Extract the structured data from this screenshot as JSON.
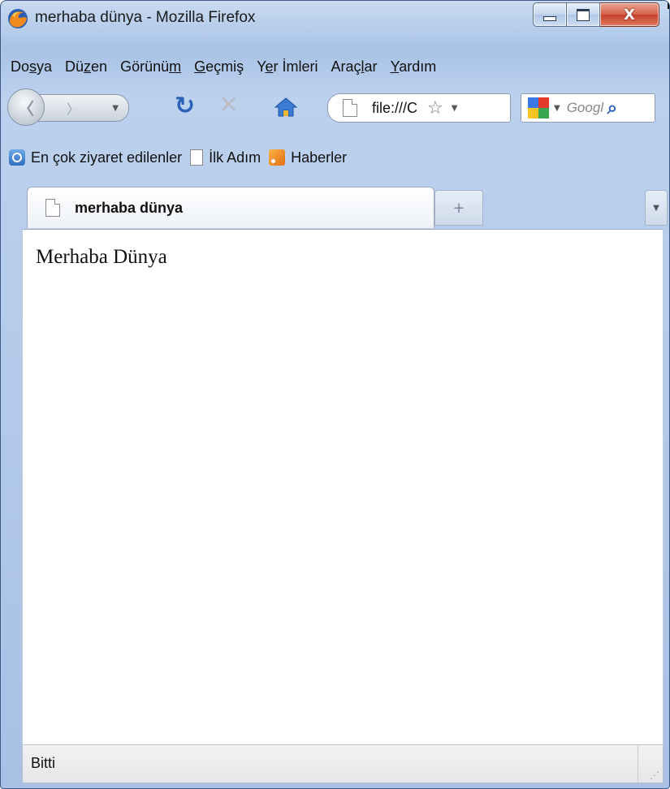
{
  "window": {
    "title": "merhaba dünya - Mozilla Firefox",
    "minimize_symbol": "",
    "close_symbol": "X"
  },
  "menu": [
    {
      "pre": "Do",
      "ul": "s",
      "post": "ya"
    },
    {
      "pre": "Dü",
      "ul": "z",
      "post": "en"
    },
    {
      "pre": "Görünü",
      "ul": "m",
      "post": ""
    },
    {
      "pre": "",
      "ul": "G",
      "post": "eçmiş"
    },
    {
      "pre": "Y",
      "ul": "e",
      "post": "r İmleri"
    },
    {
      "pre": "Araç",
      "ul": "l",
      "post": "ar"
    },
    {
      "pre": "",
      "ul": "Y",
      "post": "ardım"
    }
  ],
  "navbar": {
    "url": "file:///C",
    "search_placeholder": "Google"
  },
  "bookmarks": [
    {
      "label": "En çok ziyaret edilenler",
      "icon": "bookmark-search-icon"
    },
    {
      "label": "İlk Adım",
      "icon": "page-icon"
    },
    {
      "label": "Haberler",
      "icon": "rss-feed-icon"
    }
  ],
  "tab": {
    "title": "merhaba dünya",
    "new_tab_symbol": "+"
  },
  "content": {
    "text": "Merhaba Dünya"
  },
  "status": {
    "text": "Bitti"
  },
  "colors": {
    "frame": "#a9c3e6",
    "close_button": "#c7412a",
    "reload_blue": "#2b62b7"
  }
}
